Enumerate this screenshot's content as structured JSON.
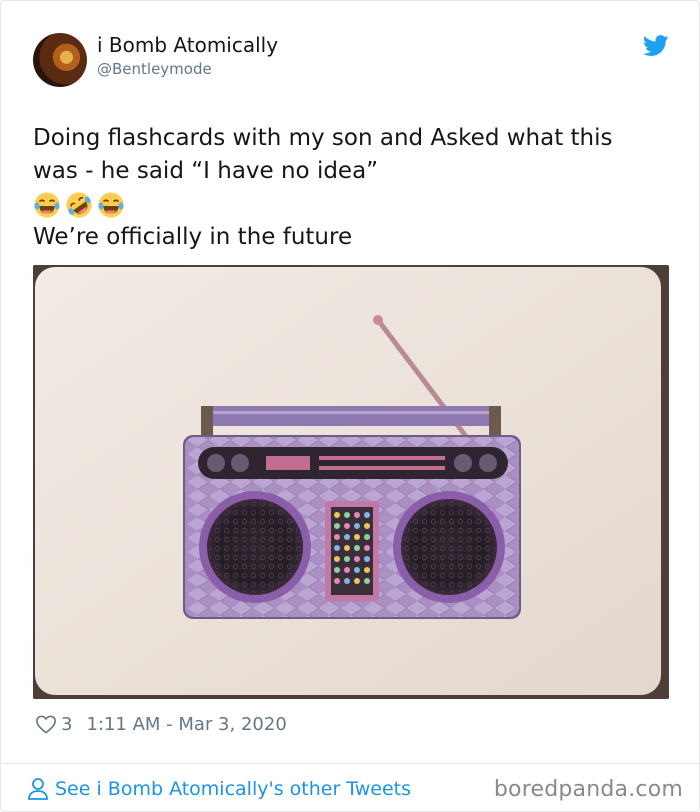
{
  "tweet": {
    "author": {
      "display_name": "i Bomb Atomically",
      "handle": "@Bentleymode"
    },
    "text_lines": [
      "Doing flashcards with my son and Asked what this",
      "was - he said “I have no idea”",
      "We’re officially in the future"
    ],
    "emojis": [
      "😂",
      "🤣",
      "😂"
    ],
    "likes": "3",
    "timestamp": "1:11 AM - Mar 3, 2020",
    "see_more": "See i Bomb Atomically's other Tweets"
  },
  "icons": {
    "brand": "twitter-bird-icon",
    "like": "heart-icon",
    "profile": "user-icon"
  },
  "colors": {
    "twitter_blue": "#1da1f2",
    "link_blue": "#1b95e0",
    "meta_gray": "#657786"
  },
  "watermark": "boredpanda.com"
}
